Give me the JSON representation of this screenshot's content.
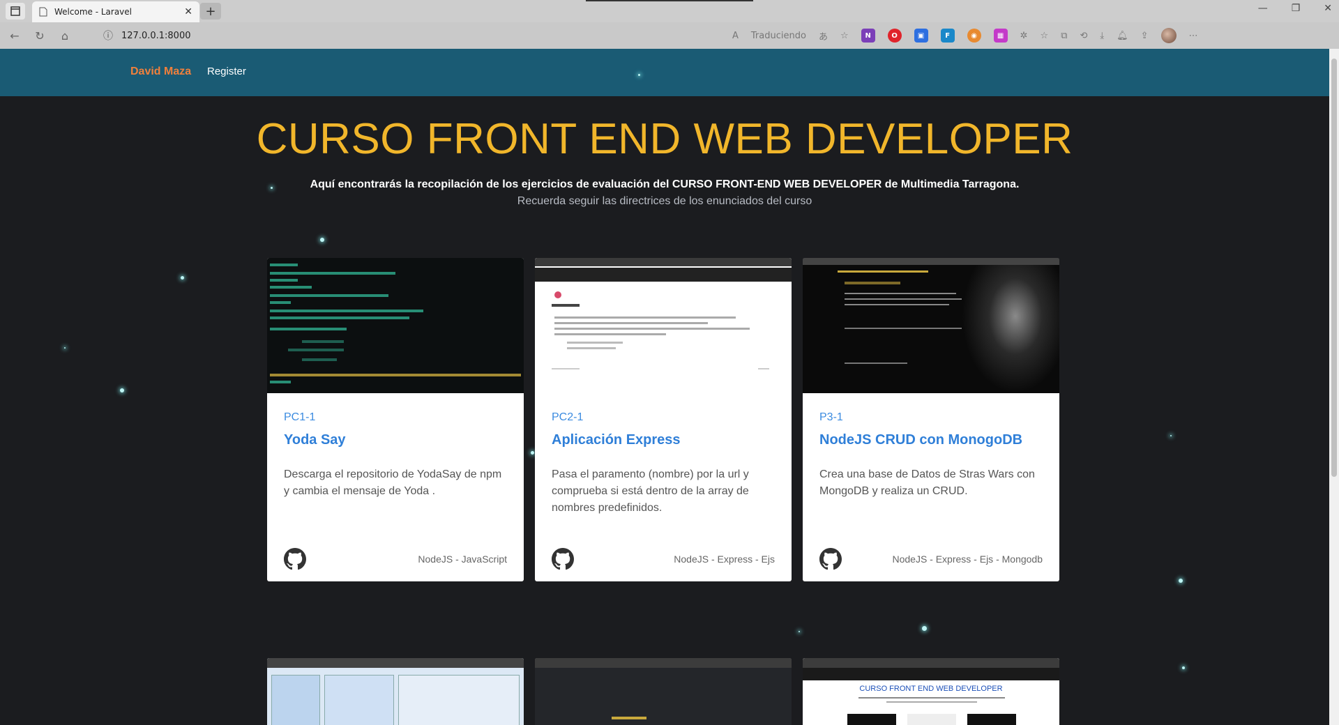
{
  "browser": {
    "tab_title": "Welcome - Laravel",
    "url": "127.0.0.1:8000",
    "translating_label": "Traduciendo"
  },
  "navbar": {
    "brand": "David Maza",
    "register": "Register"
  },
  "hero": {
    "title": "CURSO FRONT END WEB DEVELOPER",
    "subtitle": "Aquí encontrarás la recopilación de los ejercicios de evaluación del CURSO FRONT-END WEB DEVELOPER de Multimedia Tarragona.",
    "note": "Recuerda seguir las directrices de los enunciados del curso"
  },
  "cards": [
    {
      "code": "PC1-1",
      "title": "Yoda Say",
      "description": "Descarga el repositorio de YodaSay de npm y cambia el mensaje de Yoda .",
      "tags": "NodeJS - JavaScript"
    },
    {
      "code": "PC2-1",
      "title": "Aplicación Express",
      "description": "Pasa el paramento (nombre) por la url y comprueba si está dentro de la array de nombres predefinidos.",
      "tags": "NodeJS - Express - Ejs"
    },
    {
      "code": "P3-1",
      "title": "NodeJS CRUD con MonogoDB",
      "description": "Crea una base de Datos de Stras Wars con MongoDB y realiza un CRUD.",
      "tags": "NodeJS - Express - Ejs - Mongodb"
    }
  ],
  "second_row_preview": {
    "mini_title": "CURSO FRONT END WEB DEVELOPER"
  },
  "colors": {
    "navbar_bg": "#1a5b74",
    "brand": "#f0803c",
    "hero_title": "#f1b62b",
    "card_link": "#2f7fd8",
    "page_bg": "#1b1c1f"
  },
  "icons": [
    "tab-icon",
    "page-icon",
    "close-icon",
    "plus-icon",
    "back-icon",
    "reload-icon",
    "home-icon",
    "info-icon",
    "github-icon"
  ]
}
